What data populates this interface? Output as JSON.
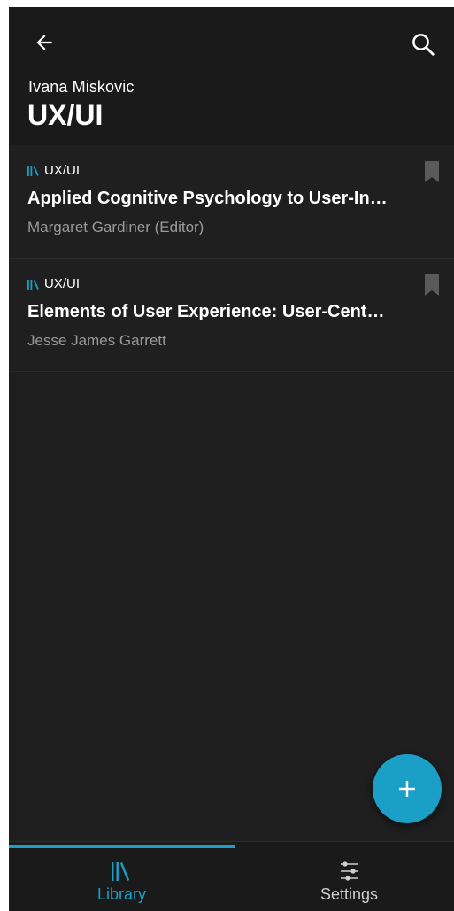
{
  "header": {
    "subtitle": "Ivana Miskovic",
    "title": "UX/UI",
    "back_icon": "arrow-left-icon",
    "search_icon": "search-icon"
  },
  "items": [
    {
      "tag": "UX/UI",
      "title": "Applied Cognitive Psychology to User-In…",
      "author": "Margaret Gardiner (Editor)"
    },
    {
      "tag": "UX/UI",
      "title": "Elements of User Experience: User-Cent…",
      "author": "Jesse James Garrett"
    }
  ],
  "fab": {
    "icon": "plus-icon"
  },
  "nav": {
    "library_label": "Library",
    "settings_label": "Settings",
    "active": "Library"
  },
  "colors": {
    "accent": "#1a9fc6",
    "background": "#1e1e1f",
    "text_secondary": "#9a9a9b"
  }
}
